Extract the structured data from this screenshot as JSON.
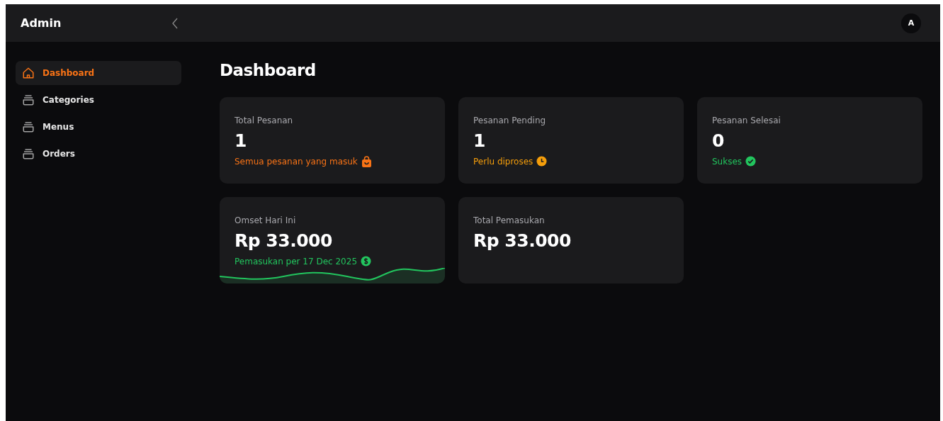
{
  "header": {
    "brand": "Admin",
    "avatar": "A"
  },
  "sidebar": {
    "items": [
      {
        "label": "Dashboard",
        "kind": "home",
        "selected": true
      },
      {
        "label": "Categories",
        "kind": "tray",
        "selected": false
      },
      {
        "label": "Menus",
        "kind": "tray",
        "selected": false
      },
      {
        "label": "Orders",
        "kind": "tray",
        "selected": false
      }
    ]
  },
  "page_title": "Dashboard",
  "cards": [
    {
      "label": "Total Pesanan",
      "value": "1",
      "note": {
        "text": "Semua pesanan yang masuk",
        "kind": "bag",
        "color": "#f97316"
      },
      "kind": "plain"
    },
    {
      "label": "Pesanan Pending",
      "value": "1",
      "note": {
        "text": "Perlu diproses",
        "kind": "clock",
        "color": "#f59e0b"
      },
      "kind": "plain"
    },
    {
      "label": "Pesanan Selesai",
      "value": "0",
      "note": {
        "text": "Sukses",
        "kind": "check",
        "color": "#22c55e"
      },
      "kind": "plain"
    },
    {
      "label": "Omset Hari Ini",
      "value": "Rp 33.000",
      "note": {
        "text": "Pemasukan per 17 Dec 2025",
        "kind": "dollar",
        "color": "#22c55e"
      },
      "kind": "wave"
    },
    {
      "label": "Total Pemasukan",
      "value": "Rp 33.000",
      "kind": "plain"
    }
  ]
}
